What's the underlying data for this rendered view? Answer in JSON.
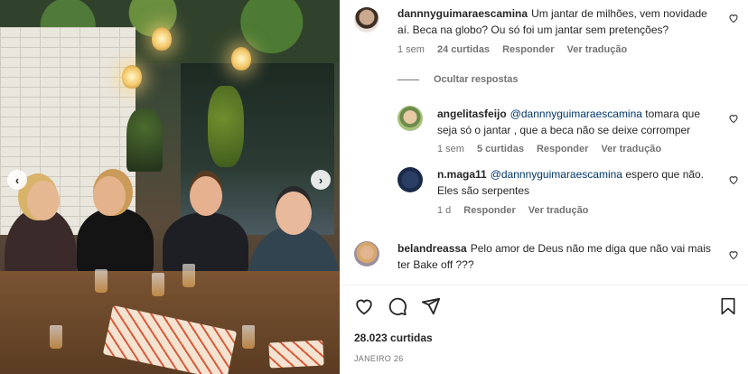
{
  "post": {
    "likes_text": "28.023 curtidas",
    "date_text": "JANEIRO 26"
  },
  "comments": [
    {
      "user": "dannnyguimaraescamina",
      "text": "Um jantar de milhões, vem novidade aí. Beca na globo? Ou só foi um jantar sem pretenções?",
      "time": "1 sem",
      "likes": "24 curtidas",
      "reply": "Responder",
      "translate": "Ver tradução"
    },
    {
      "user": "angelitasfeijo",
      "mention": "@dannnyguimaraescamina",
      "text": "tomara que seja só o jantar , que a beca não se deixe corromper",
      "time": "1 sem",
      "likes": "5 curtidas",
      "reply": "Responder",
      "translate": "Ver tradução"
    },
    {
      "user": "n.maga11",
      "mention": "@dannnyguimaraescamina",
      "text": "espero que não. Eles são serpentes",
      "time": "1 d",
      "reply": "Responder",
      "translate": "Ver tradução"
    },
    {
      "user": "belandreassa",
      "text": "Pelo amor de Deus não me diga que não vai mais ter Bake off ???"
    }
  ],
  "hide_replies": "Ocultar respostas",
  "icons": {
    "like": "heart-icon",
    "comment": "comment-icon",
    "share": "send-icon",
    "save": "bookmark-icon",
    "prev": "chevron-left-icon",
    "next": "chevron-right-icon"
  },
  "colors": {
    "text": "#262626",
    "muted": "#737373",
    "mention": "#00376b"
  }
}
